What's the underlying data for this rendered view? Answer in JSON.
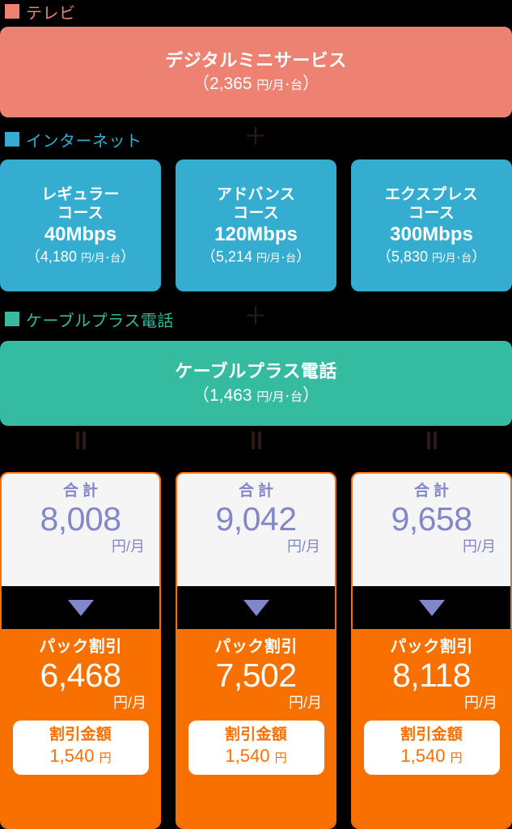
{
  "sections": {
    "tv": {
      "legend_label": "テレビ",
      "legend_color": "#ED8272",
      "product_name": "デジタルミニサービス",
      "price": "（2,365 ",
      "price_unit": "円/月･台",
      "price_close": "）"
    },
    "internet": {
      "legend_label": "インターネット",
      "legend_color": "#35ADD0",
      "plus": "＋",
      "courses": [
        {
          "name": "レギュラー\nコース",
          "name_line1": "レギュラー",
          "name_line2": "コース",
          "speed": "40Mbps",
          "price_open": "（4,180 ",
          "price_unit": "円/月･台",
          "price_close": "）"
        },
        {
          "name": "アドバンス\nコース",
          "name_line1": "アドバンス",
          "name_line2": "コース",
          "speed": "120Mbps",
          "price_open": "（5,214 ",
          "price_unit": "円/月･台",
          "price_close": "）"
        },
        {
          "name": "エクスプレス\nコース",
          "name_line1": "エクスプレス",
          "name_line2": "コース",
          "speed": "300Mbps",
          "price_open": "（5,830 ",
          "price_unit": "円/月･台",
          "price_close": "）"
        }
      ]
    },
    "phone": {
      "legend_label": "ケーブルプラス電話",
      "legend_color": "#34BBA0",
      "plus": "＋",
      "product_name": "ケーブルプラス電話",
      "price_open": "（1,463 ",
      "price_unit": "円/月･台",
      "price_close": "）"
    }
  },
  "results": [
    {
      "total_label": "合計",
      "total_value": "8,008",
      "total_unit": "円/月",
      "discount_label": "パック割引",
      "discount_value": "6,468",
      "discount_unit": "円/月",
      "saving_label": "割引金額",
      "saving_amount": "1,540 ",
      "saving_unit": "円"
    },
    {
      "total_label": "合計",
      "total_value": "9,042",
      "total_unit": "円/月",
      "discount_label": "パック割引",
      "discount_value": "7,502",
      "discount_unit": "円/月",
      "saving_label": "割引金額",
      "saving_amount": "1,540 ",
      "saving_unit": "円"
    },
    {
      "total_label": "合計",
      "total_value": "9,658",
      "total_unit": "円/月",
      "discount_label": "パック割引",
      "discount_value": "8,118",
      "discount_unit": "円/月",
      "saving_label": "割引金額",
      "saving_amount": "1,540 ",
      "saving_unit": "円"
    }
  ],
  "colors": {
    "tv": "#ED8272",
    "internet": "#35ADD0",
    "phone": "#34BBA0",
    "discount": "#F87000",
    "total_text": "#8187C8",
    "total_bg": "#F5F5F5",
    "background": "#000000",
    "operator": "#2B1A16"
  }
}
